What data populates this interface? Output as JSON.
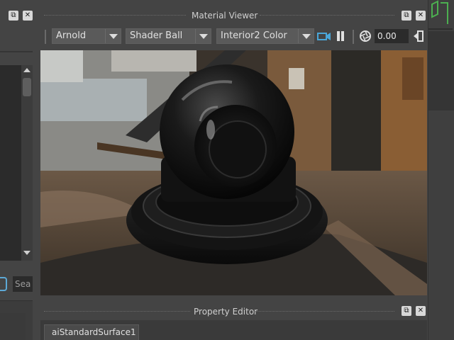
{
  "left_panel": {
    "search_placeholder": "Sea"
  },
  "material_viewer": {
    "title": "Material Viewer",
    "toolbar": {
      "renderer": "Arnold",
      "shape": "Shader Ball",
      "environment": "Interior2 Color",
      "exposure": "0.00"
    }
  },
  "property_editor": {
    "title": "Property Editor",
    "tab_label": "aiStandardSurface1"
  },
  "window_controls": {
    "float_icon": "float-window-icon",
    "close_icon": "close-icon"
  },
  "colors": {
    "panel_bg": "#444444",
    "field_bg": "#2b2b2b",
    "accent_blue": "#5da9d6",
    "accent_green": "#4caf50"
  }
}
